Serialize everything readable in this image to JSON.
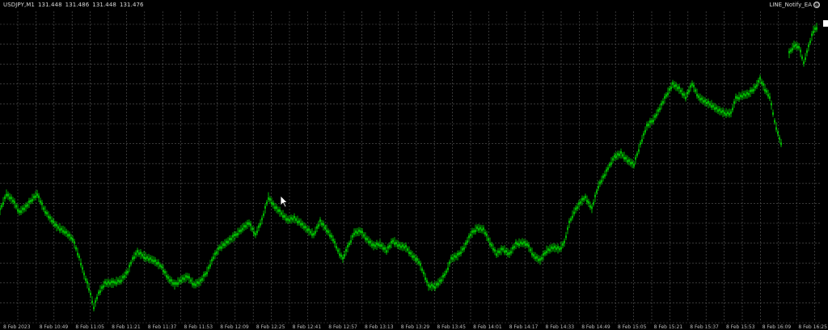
{
  "header": {
    "symbol": "USDJPY,M1",
    "bid": "131.448",
    "high": "131.486",
    "low": "131.448",
    "close": "131.476"
  },
  "expert": {
    "name": "LINE_Notify_EA",
    "icon": "smiley-icon"
  },
  "colors": {
    "background": "#000000",
    "grid": "#5a5a5a",
    "candles": "#00e000",
    "text": "#d8d8d8"
  },
  "time_axis": {
    "labels": [
      "8 Feb 2023",
      "8 Feb 10:49",
      "8 Feb 11:05",
      "8 Feb 11:21",
      "8 Feb 11:37",
      "8 Feb 11:53",
      "8 Feb 12:09",
      "8 Feb 12:25",
      "8 Feb 12:41",
      "8 Feb 12:57",
      "8 Feb 13:13",
      "8 Feb 13:29",
      "8 Feb 13:45",
      "8 Feb 14:01",
      "8 Feb 14:17",
      "8 Feb 14:33",
      "8 Feb 14:49",
      "8 Feb 15:05",
      "8 Feb 15:21",
      "8 Feb 15:37",
      "8 Feb 15:53",
      "8 Feb 16:09",
      "8 Feb 16:25"
    ]
  },
  "cursor": {
    "icon": "arrow-cursor-icon"
  }
}
